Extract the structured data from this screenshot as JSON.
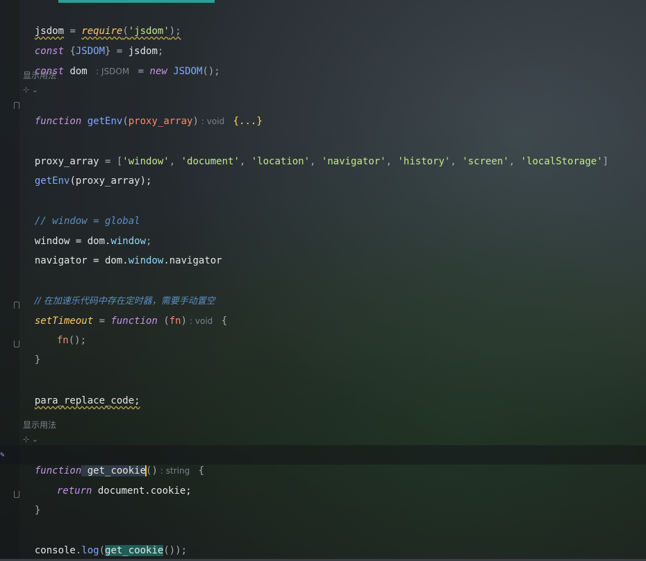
{
  "editor": {
    "accent_color": "#2aa198",
    "lines": {
      "l1": {
        "a": "jsdom",
        "b": " = ",
        "c": "require",
        "d": "(",
        "e": "'jsdom'",
        "f": ");"
      },
      "l2": {
        "a": "const",
        "b": " {",
        "c": "JSDOM",
        "d": "} = ",
        "e": "jsdom",
        "f": ";"
      },
      "l3": {
        "a": "const",
        "b": " dom ",
        "inlay": ": JSDOM",
        "c": " = ",
        "d": "new",
        "e": " JSDOM",
        "f": "();"
      },
      "hint1": "显示用法",
      "l5": {
        "a": "function",
        "b": " getEnv",
        "c": "(",
        "d": "proxy_array",
        "e": ")",
        "inlay": ": void",
        "f": "{...}"
      },
      "l7": {
        "a": "proxy_array",
        "b": " = [",
        "s1": "'window'",
        "s2": "'document'",
        "s3": "'location'",
        "s4": "'navigator'",
        "s5": "'history'",
        "s6": "'screen'",
        "s7": "'localStorage'",
        "sep": ", ",
        "end": "]"
      },
      "l8": {
        "a": "getEnv",
        "b": "(proxy_array);"
      },
      "l10": "// window = global",
      "l11": {
        "a": "window",
        "b": " = dom.",
        "c": "window",
        "d": ";"
      },
      "l12": {
        "a": "navigator",
        "b": " = dom.",
        "c": "window",
        "d": ".navigator"
      },
      "l14": "// 在加速乐代码中存在定时器，需要手动置空",
      "l15": {
        "a": "setTimeout",
        "b": " = ",
        "c": "function",
        "d": " (",
        "e": "fn",
        "f": ")",
        "inlay": ": void",
        "g": "{"
      },
      "l16": {
        "a": "fn",
        "b": "();"
      },
      "l17": "}",
      "l19": "para_replace_code;",
      "hint2": "显示用法",
      "l21": {
        "a": "function",
        "b": " get_cookie",
        "c": "()",
        "inlay": ": string",
        "d": "{"
      },
      "l22": {
        "a": "return",
        "b": " document.cookie;"
      },
      "l23": "}",
      "l25": {
        "a": "console",
        "b": ".",
        "c": "log",
        "d": "(",
        "e": "get_cookie",
        "f": "());"
      }
    }
  }
}
